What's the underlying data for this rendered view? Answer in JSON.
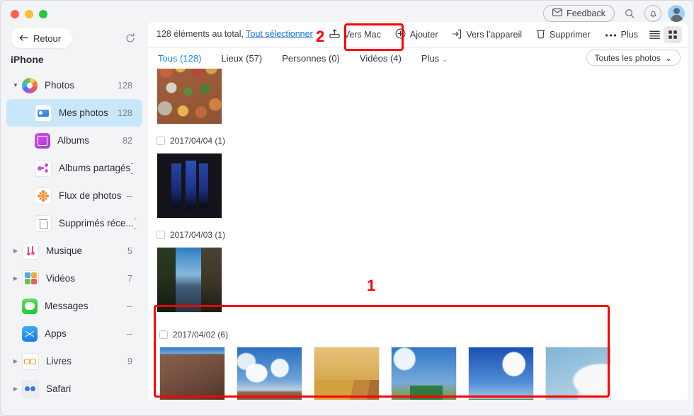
{
  "window": {
    "traffic_lights": [
      "close",
      "minimize",
      "maximize"
    ],
    "colors": {
      "accent": "#1a86ef",
      "annotation": "#ff0000",
      "selected_row": "#c9e7fb"
    }
  },
  "header": {
    "feedback_label": "Feedback",
    "icons": [
      "envelope-icon",
      "search-icon",
      "bell-icon",
      "avatar"
    ]
  },
  "sidebar": {
    "back_label": "Retour",
    "refresh_icon": "refresh-icon",
    "device_name": "iPhone",
    "items": [
      {
        "label": "Photos",
        "count": "128",
        "icon": "photos-icon",
        "caret": "down",
        "selected": false,
        "child": false
      },
      {
        "label": "Mes photos",
        "count": "128",
        "icon": "my-photos-icon",
        "caret": "",
        "selected": true,
        "child": true
      },
      {
        "label": "Albums",
        "count": "82",
        "icon": "albums-icon",
        "caret": "",
        "selected": false,
        "child": true
      },
      {
        "label": "Albums partagés",
        "count": "--",
        "icon": "shared-albums-icon",
        "caret": "",
        "selected": false,
        "child": true
      },
      {
        "label": "Flux de photos",
        "count": "--",
        "icon": "photo-stream-icon",
        "caret": "",
        "selected": false,
        "child": true
      },
      {
        "label": "Supprimés réce...",
        "count": "--",
        "icon": "trash-icon",
        "caret": "",
        "selected": false,
        "child": true
      },
      {
        "label": "Musique",
        "count": "5",
        "icon": "music-icon",
        "caret": "right",
        "selected": false,
        "child": false
      },
      {
        "label": "Vidéos",
        "count": "7",
        "icon": "video-icon",
        "caret": "right",
        "selected": false,
        "child": false
      },
      {
        "label": "Messages",
        "count": "--",
        "icon": "messages-icon",
        "caret": "",
        "selected": false,
        "child": false
      },
      {
        "label": "Apps",
        "count": "--",
        "icon": "apps-icon",
        "caret": "",
        "selected": false,
        "child": false
      },
      {
        "label": "Livres",
        "count": "9",
        "icon": "books-icon",
        "caret": "right",
        "selected": false,
        "child": false
      },
      {
        "label": "Safari",
        "count": "",
        "icon": "safari-icon",
        "caret": "right",
        "selected": false,
        "child": false
      }
    ]
  },
  "toolbar": {
    "status_text": "128 éléments au total,",
    "select_all_label": "Tout sélectionner",
    "actions": [
      {
        "label": "Vers Mac",
        "icon": "export-to-mac-icon",
        "highlighted": true
      },
      {
        "label": "Ajouter",
        "icon": "plus-circle-icon",
        "highlighted": false
      },
      {
        "label": "Vers l’appareil",
        "icon": "import-to-device-icon",
        "highlighted": false
      },
      {
        "label": "Supprimer",
        "icon": "trash-icon",
        "highlighted": false
      },
      {
        "label": "Plus",
        "icon": "more-dots-icon",
        "highlighted": false
      }
    ],
    "view_list_icon": "list-view-icon",
    "view_grid_icon": "grid-view-icon",
    "active_view": "grid"
  },
  "tabs": [
    {
      "label": "Tous (128)",
      "active": true
    },
    {
      "label": "Lieux (57)",
      "active": false
    },
    {
      "label": "Personnes (0)",
      "active": false
    },
    {
      "label": "Vidéos (4)",
      "active": false
    },
    {
      "label": "Plus",
      "active": false,
      "has_chevron": true
    }
  ],
  "filter": {
    "label": "Toutes les photos",
    "icon": "chevron-down-icon"
  },
  "photo_groups": [
    {
      "date": "",
      "count_label": "",
      "partial_top": true,
      "photos": [
        {
          "name": "crowd-festival"
        }
      ]
    },
    {
      "date": "2017/04/04 (1)",
      "photos": [
        {
          "name": "stained-glass-window"
        }
      ]
    },
    {
      "date": "2017/04/03 (1)",
      "photos": [
        {
          "name": "canal-trees"
        }
      ]
    },
    {
      "date": "2017/04/02 (6)",
      "photos": [
        {
          "name": "brick-corner-building"
        },
        {
          "name": "museum-square-clouds"
        },
        {
          "name": "wooden-clogs"
        },
        {
          "name": "green-windmill"
        },
        {
          "name": "windmill-blue-sky"
        },
        {
          "name": "blossom-tree"
        }
      ]
    }
  ],
  "annotations": [
    {
      "number": "1",
      "target": "photo-group-2017-04-02"
    },
    {
      "number": "2",
      "target": "vers-mac-button"
    }
  ]
}
